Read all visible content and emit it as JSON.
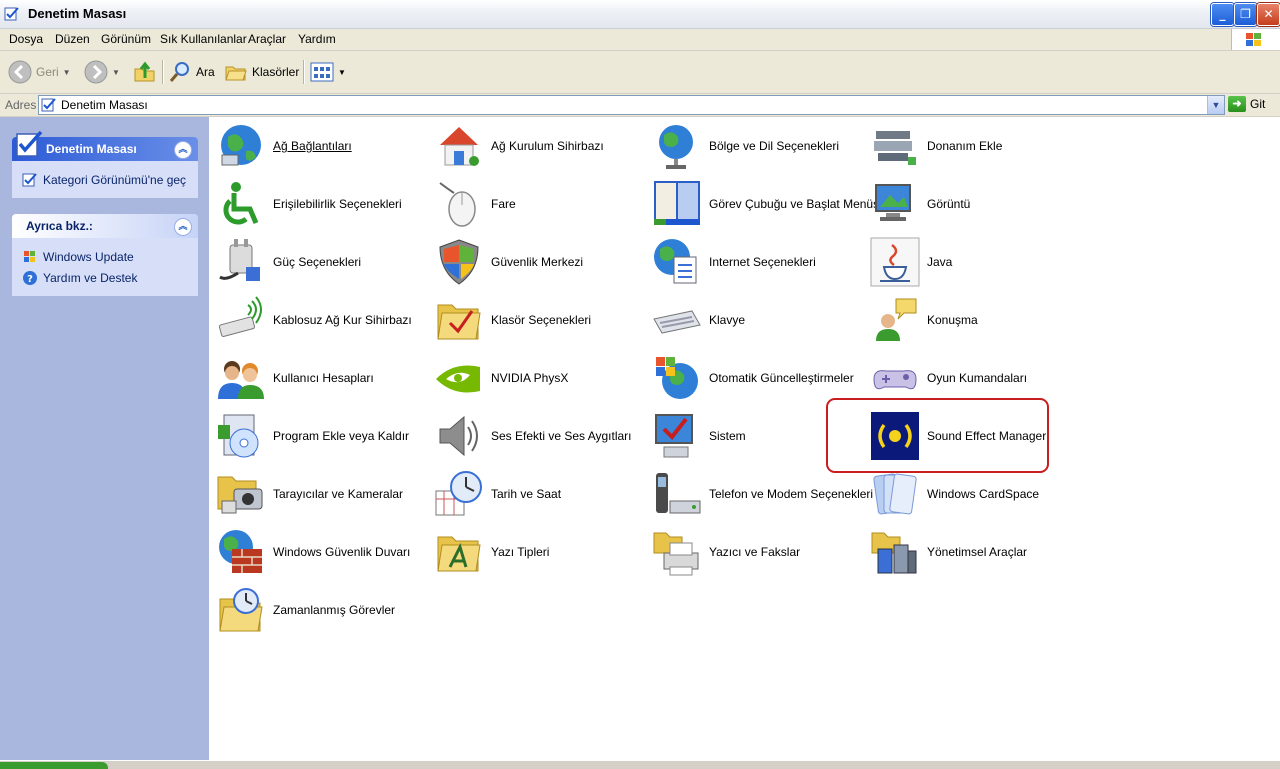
{
  "window": {
    "title": "Denetim Masası"
  },
  "menu": [
    "Dosya",
    "Düzen",
    "Görünüm",
    "Sık Kullanılanlar",
    "Araçlar",
    "Yardım"
  ],
  "toolbar": {
    "back": "Geri",
    "search": "Ara",
    "folders": "Klasörler"
  },
  "address": {
    "label": "Adres",
    "value": "Denetim Masası",
    "go": "Git"
  },
  "left": {
    "panel1": {
      "title": "Denetim Masası",
      "links": [
        "Kategori Görünümü'ne geç"
      ]
    },
    "panel2": {
      "title": "Ayrıca bkz.:",
      "links": [
        "Windows Update",
        "Yardım ve Destek"
      ]
    }
  },
  "items": [
    "Ağ Bağlantıları",
    "Ağ Kurulum Sihirbazı",
    "Bölge ve Dil Seçenekleri",
    "Donanım Ekle",
    "Erişilebilirlik Seçenekleri",
    "Fare",
    "Görev Çubuğu ve Başlat Menüsü",
    "Görüntü",
    "Güç Seçenekleri",
    "Güvenlik Merkezi",
    "Internet Seçenekleri",
    "Java",
    "Kablosuz Ağ Kur Sihirbazı",
    "Klasör Seçenekleri",
    "Klavye",
    "Konuşma",
    "Kullanıcı Hesapları",
    "NVIDIA PhysX",
    "Otomatik Güncelleştirmeler",
    "Oyun Kumandaları",
    "Program Ekle veya Kaldır",
    "Ses Efekti ve Ses Aygıtları",
    "Sistem",
    "Sound Effect Manager",
    "Tarayıcılar ve Kameralar",
    "Tarih ve Saat",
    "Telefon ve Modem Seçenekleri",
    "Windows CardSpace",
    "Windows Güvenlik Duvarı",
    "Yazı Tipleri",
    "Yazıcı ve Fakslar",
    "Yönetimsel Araçlar",
    "Zamanlanmış Görevler"
  ],
  "colors": {
    "highlight": "#c81e1e",
    "panel_blue": "#2d5bd6"
  }
}
